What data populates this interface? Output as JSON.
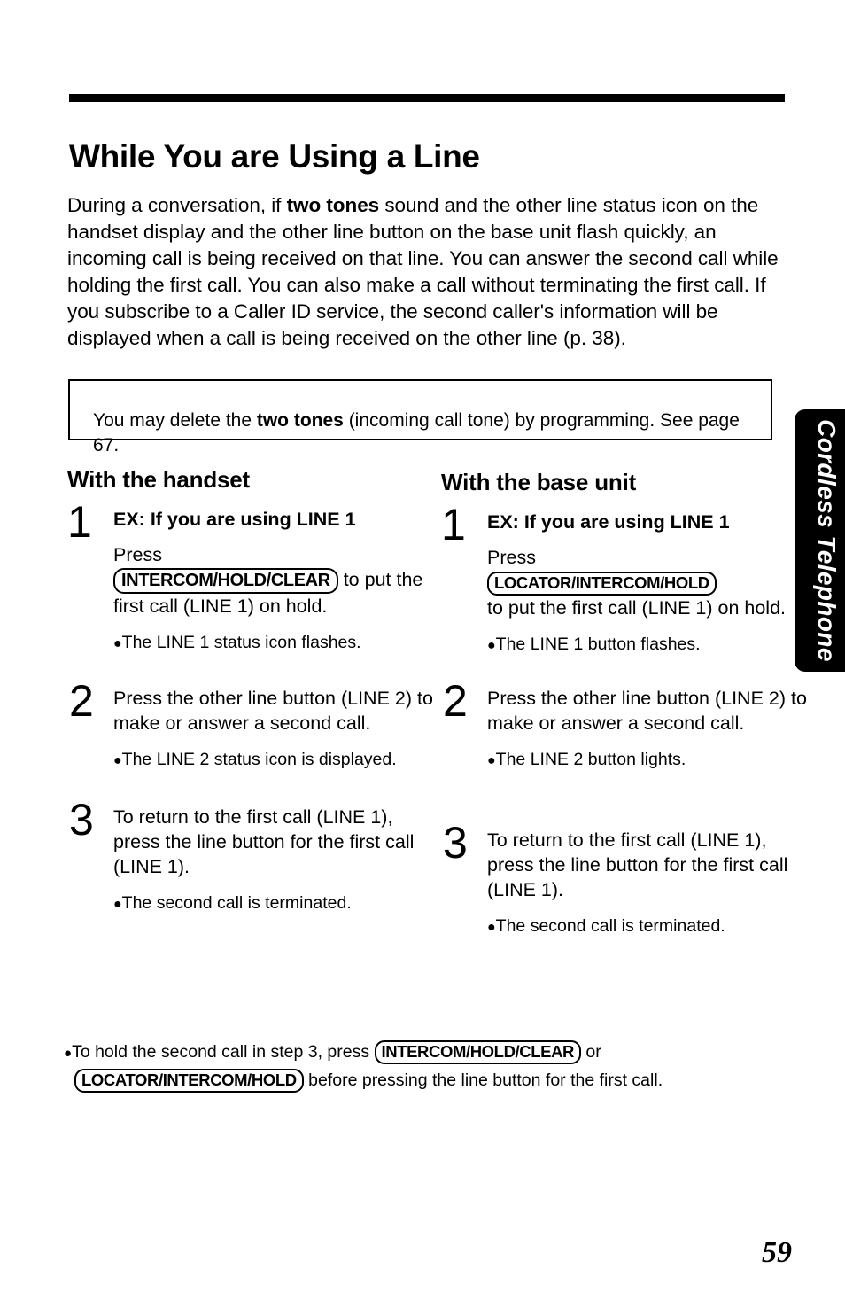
{
  "document": {
    "page_number": "59",
    "side_tab_label": "Cordless Telephone"
  },
  "header": {
    "title": "While You are Using a Line"
  },
  "intro": {
    "part1": "During a conversation, if ",
    "bold1": "two tones",
    "part2": " sound and the other line status icon on the handset display and the other line button on the base unit flash quickly, an incoming call is being received on that line. You can answer the second call while holding the first call. You can also make a call without terminating the first call. If you subscribe to a Caller ID service, the second caller's information will be displayed when a call is being received on the other line (p. 38)."
  },
  "note_box": {
    "part1": "You may delete the ",
    "bold1": "two tones",
    "part2": " (incoming call tone) by programming. See page 67."
  },
  "columns": [
    {
      "heading": "With the handset",
      "steps": [
        {
          "number": "1",
          "lead": "EX: If you are using LINE 1",
          "body_before": "Press",
          "keycap": "INTERCOM/HOLD/CLEAR",
          "body_after": " to put the first call (LINE 1) on hold.",
          "sub": "The LINE 1 status icon flashes."
        },
        {
          "number": "2",
          "body": "Press the other line button (LINE 2) to make or answer a second call.",
          "sub": "The LINE 2 status icon is displayed."
        },
        {
          "number": "3",
          "body": "To return to the first call (LINE 1), press the line button for the first call (LINE 1).",
          "sub": "The second call is terminated."
        }
      ]
    },
    {
      "heading": "With the base unit",
      "steps": [
        {
          "number": "1",
          "lead": "EX: If you are using LINE 1",
          "body_before": "Press",
          "keycap": "LOCATOR/INTERCOM/HOLD",
          "body_after": "to put the first call (LINE 1) on hold.",
          "sub": "The LINE 1 button flashes."
        },
        {
          "number": "2",
          "body": "Press the other line button (LINE 2) to make or answer a second call.",
          "sub": "The LINE 2 button lights."
        },
        {
          "number": "3",
          "body": "To return to the first call (LINE 1), press the line button for the first call (LINE 1).",
          "sub": "The second call is terminated."
        }
      ]
    }
  ],
  "bottom_note": {
    "text1": "To hold the second call in step 3, press ",
    "keycap1": "INTERCOM/HOLD/CLEAR",
    "text2": " or",
    "keycap2": "LOCATOR/INTERCOM/HOLD",
    "text3": " before pressing the line button for the first call."
  }
}
